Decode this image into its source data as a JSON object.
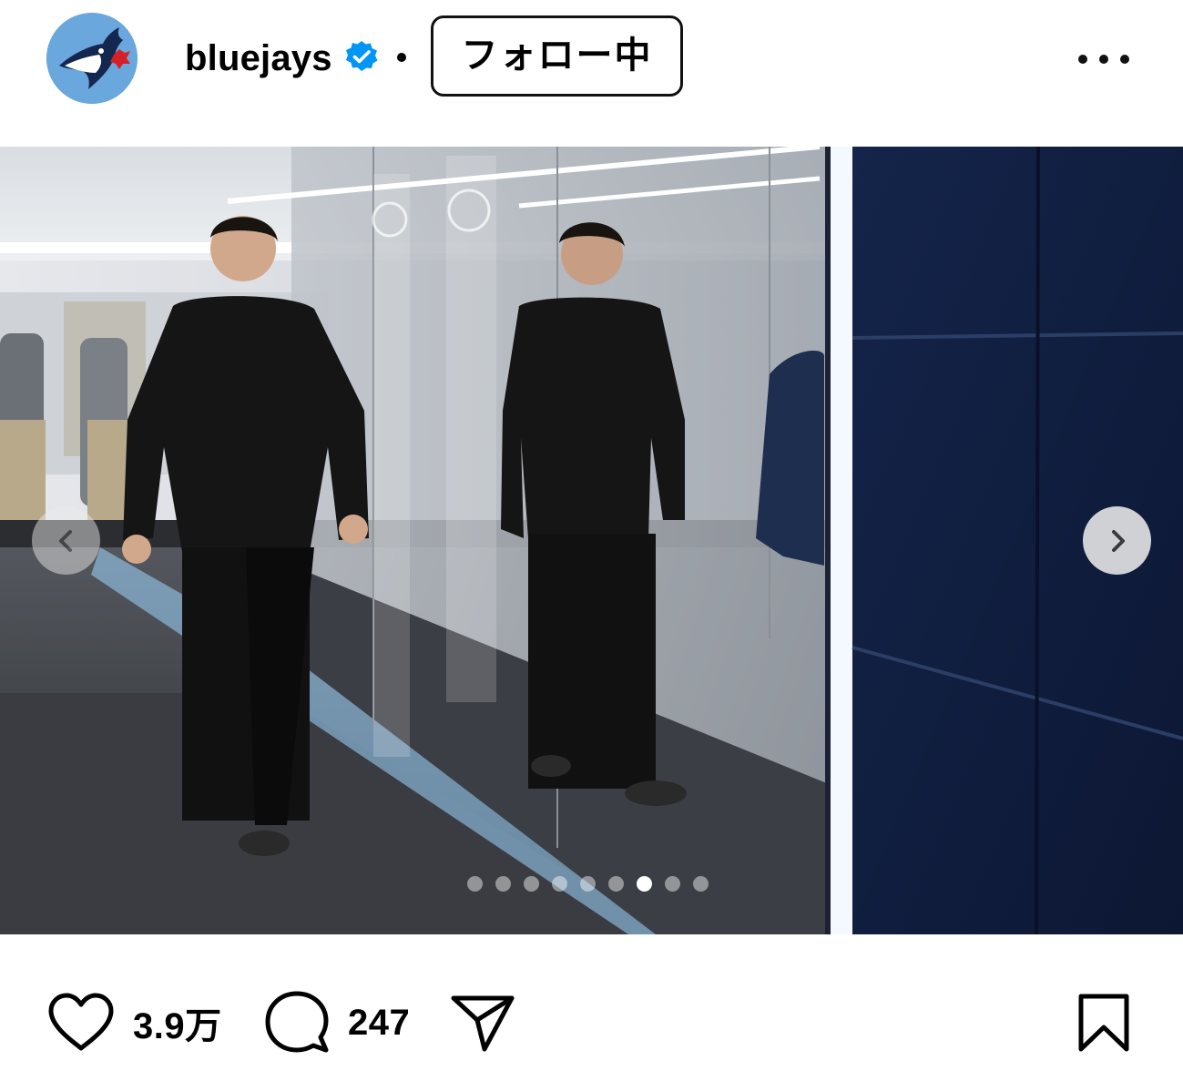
{
  "post": {
    "username": "bluejays",
    "follow_label": "フォロー中",
    "image_alt": "Player in black outfit walking down a mirrored stadium corridor",
    "carousel": {
      "total": 9,
      "active_index": 6
    }
  },
  "actions": {
    "likes": "3.9万",
    "comments": "247"
  },
  "icons": {
    "avatar": "blue-jays-logo",
    "verified": "verified-badge-icon",
    "more": "more-options-icon",
    "prev": "chevron-left-icon",
    "next": "chevron-right-icon",
    "like": "heart-icon",
    "comment": "comment-bubble-icon",
    "share": "paper-plane-icon",
    "save": "bookmark-icon"
  },
  "colors": {
    "verified_blue": "#0095f6",
    "avatar_bg": "#6aa7dc",
    "text": "#000000"
  }
}
